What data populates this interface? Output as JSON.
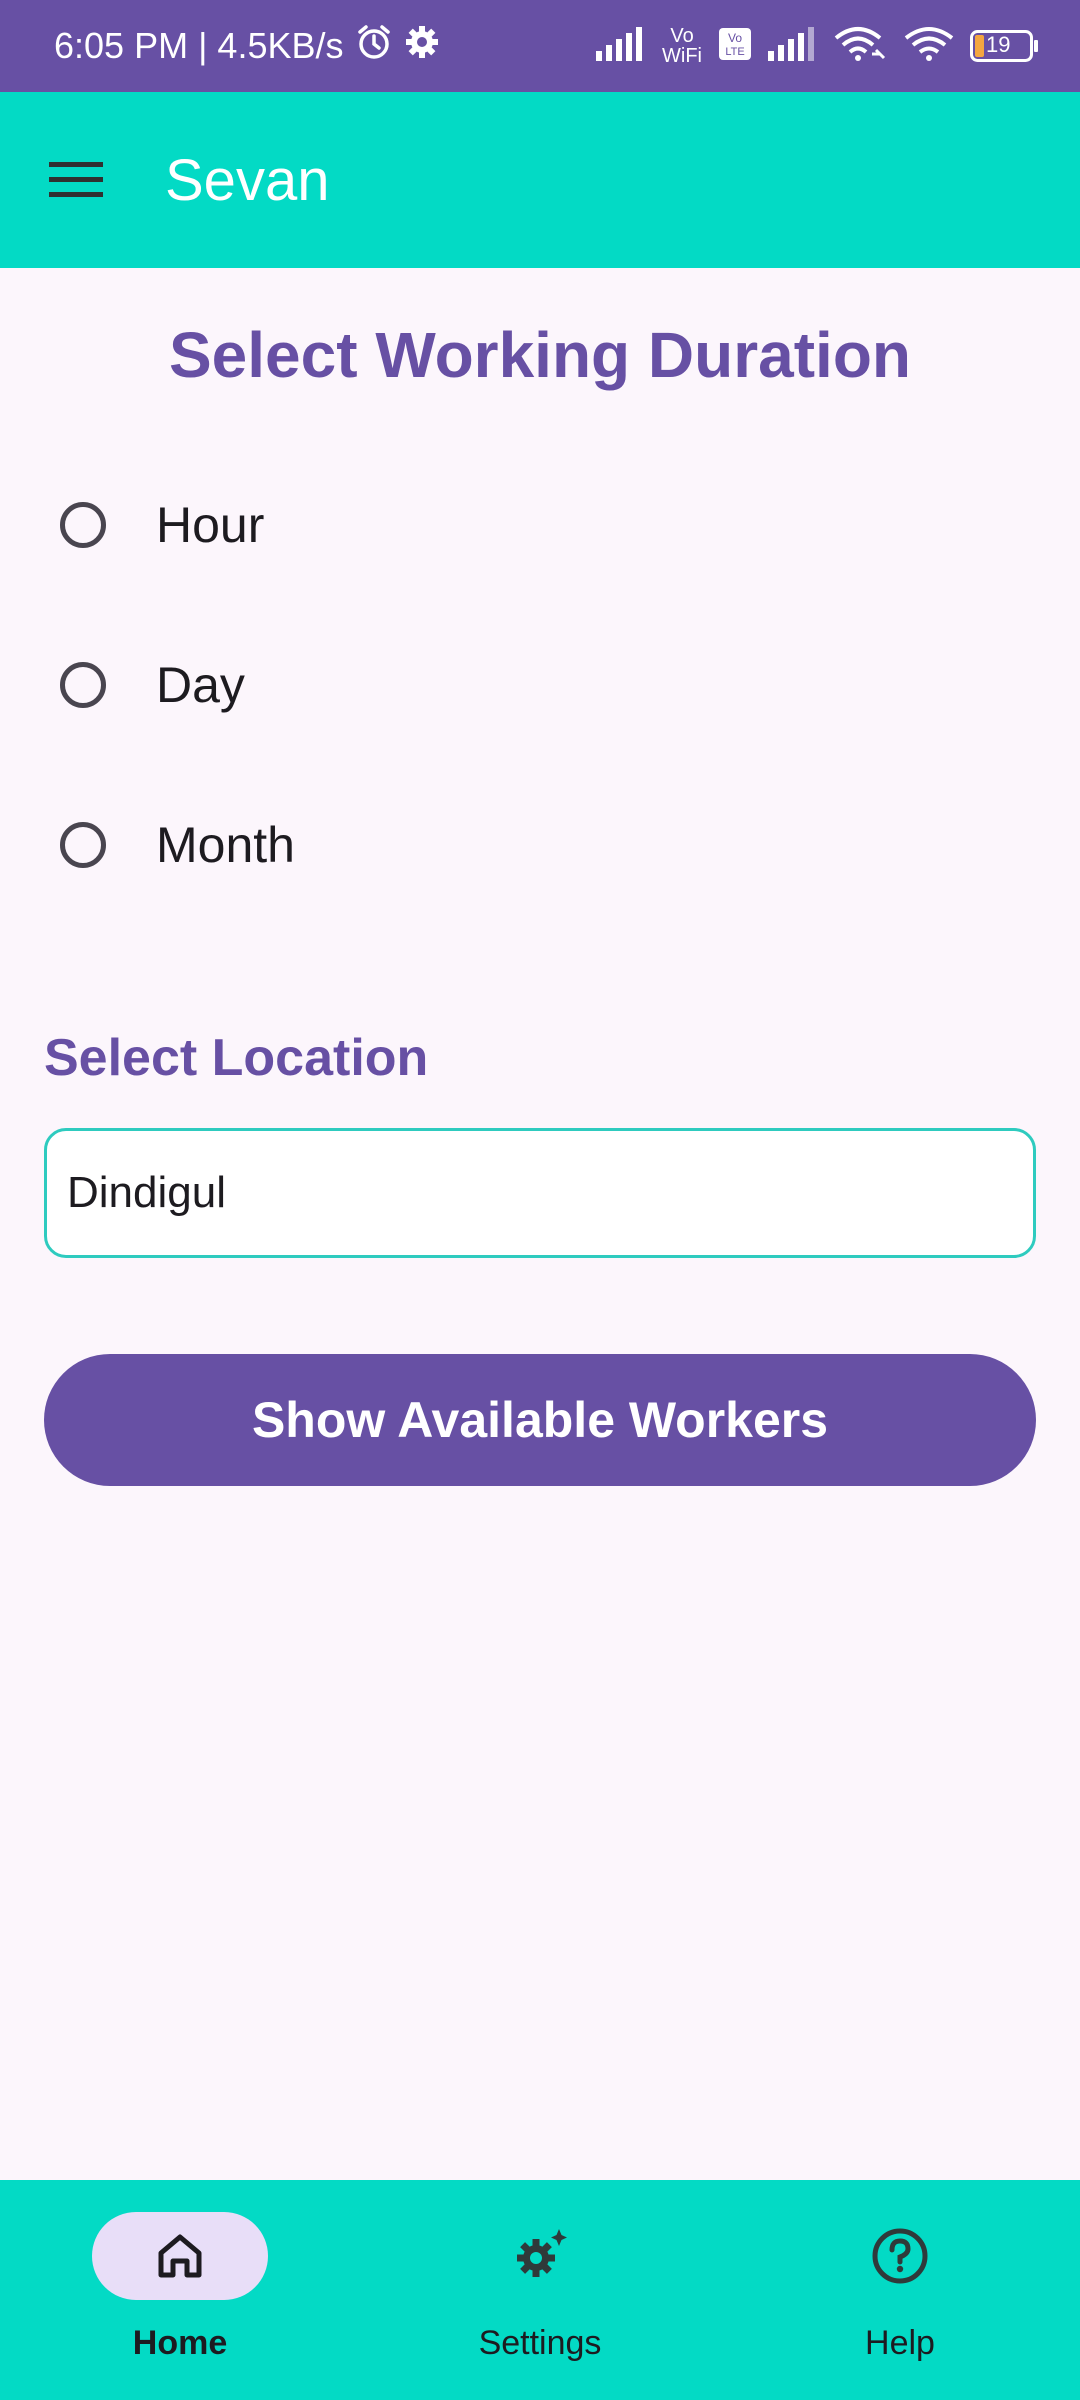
{
  "status_bar": {
    "time_speed": "6:05 PM | 4.5KB/s",
    "battery": "19",
    "icons": [
      "alarm-icon",
      "settings-icon",
      "signal-icon",
      "vowifi-icon",
      "volte-icon",
      "signal-icon",
      "wifi-link-icon",
      "wifi-icon",
      "battery-icon"
    ]
  },
  "app_bar": {
    "title": "Sevan"
  },
  "duration": {
    "title": "Select Working Duration",
    "options": [
      "Hour",
      "Day",
      "Month"
    ]
  },
  "location": {
    "title": "Select Location",
    "value": "Dindigul"
  },
  "show_button": {
    "label": "Show Available Workers"
  },
  "bottom_nav": {
    "items": [
      {
        "label": "Home",
        "icon": "home-icon",
        "active": true
      },
      {
        "label": "Settings",
        "icon": "settings-sparkle-icon",
        "active": false
      },
      {
        "label": "Help",
        "icon": "help-icon",
        "active": false
      }
    ]
  },
  "colors": {
    "primary": "#6750a4",
    "teal": "#03dac5",
    "background": "#fcf6fc",
    "active_pill": "#e8def8"
  }
}
